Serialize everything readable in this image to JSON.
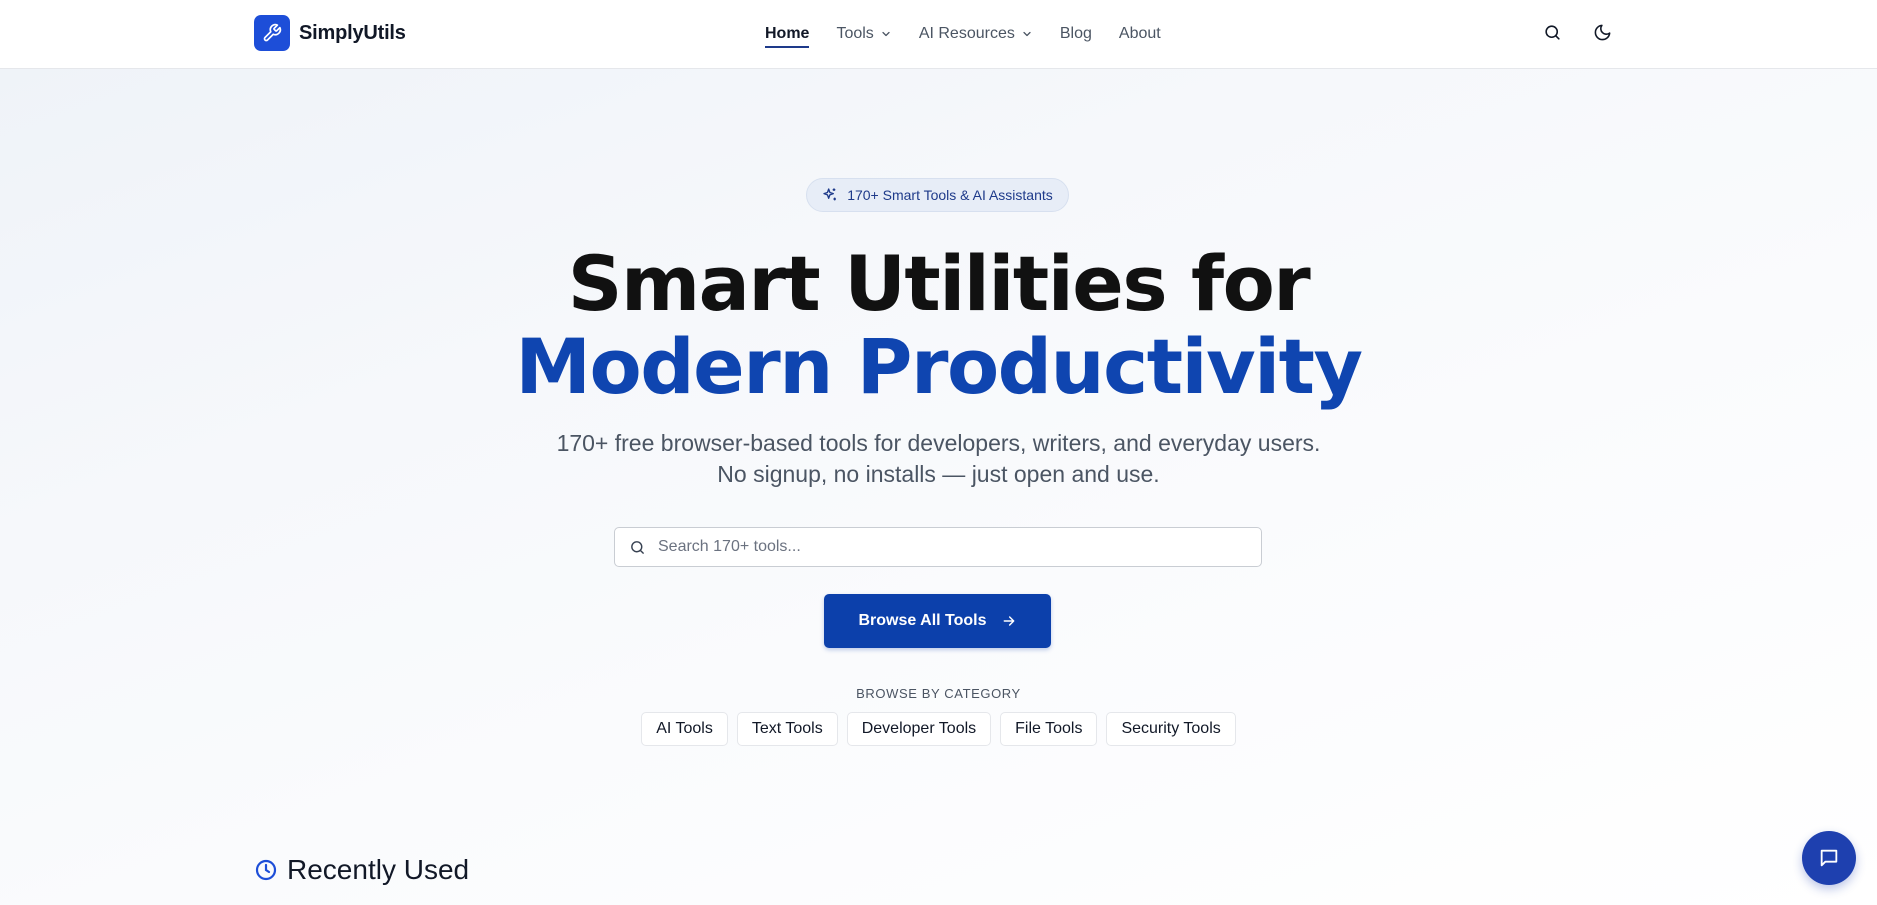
{
  "header": {
    "logo_text": "SimplyUtils",
    "nav": [
      {
        "label": "Home",
        "active": true
      },
      {
        "label": "Tools",
        "dropdown": true
      },
      {
        "label": "AI Resources",
        "dropdown": true
      },
      {
        "label": "Blog"
      },
      {
        "label": "About"
      }
    ],
    "icons": [
      "search-icon",
      "moon-icon"
    ]
  },
  "hero": {
    "badge": "170+ Smart Tools & AI Assistants",
    "title_line1": "Smart Utilities for",
    "title_line2": "Modern Productivity",
    "subtitle_line1": "170+ free browser-based tools for developers, writers, and everyday users.",
    "subtitle_line2": "No signup, no installs — just open and use.",
    "search_placeholder": "Search 170+ tools...",
    "cta_label": "Browse All Tools"
  },
  "categories": {
    "label": "BROWSE BY CATEGORY",
    "items": [
      "AI Tools",
      "Text Tools",
      "Developer Tools",
      "File Tools",
      "Security Tools"
    ]
  },
  "recent": {
    "title": "Recently Used"
  },
  "colors": {
    "brand": "#1d4ed8",
    "title_accent": "#0f45b0",
    "cta": "#0c40ab"
  }
}
